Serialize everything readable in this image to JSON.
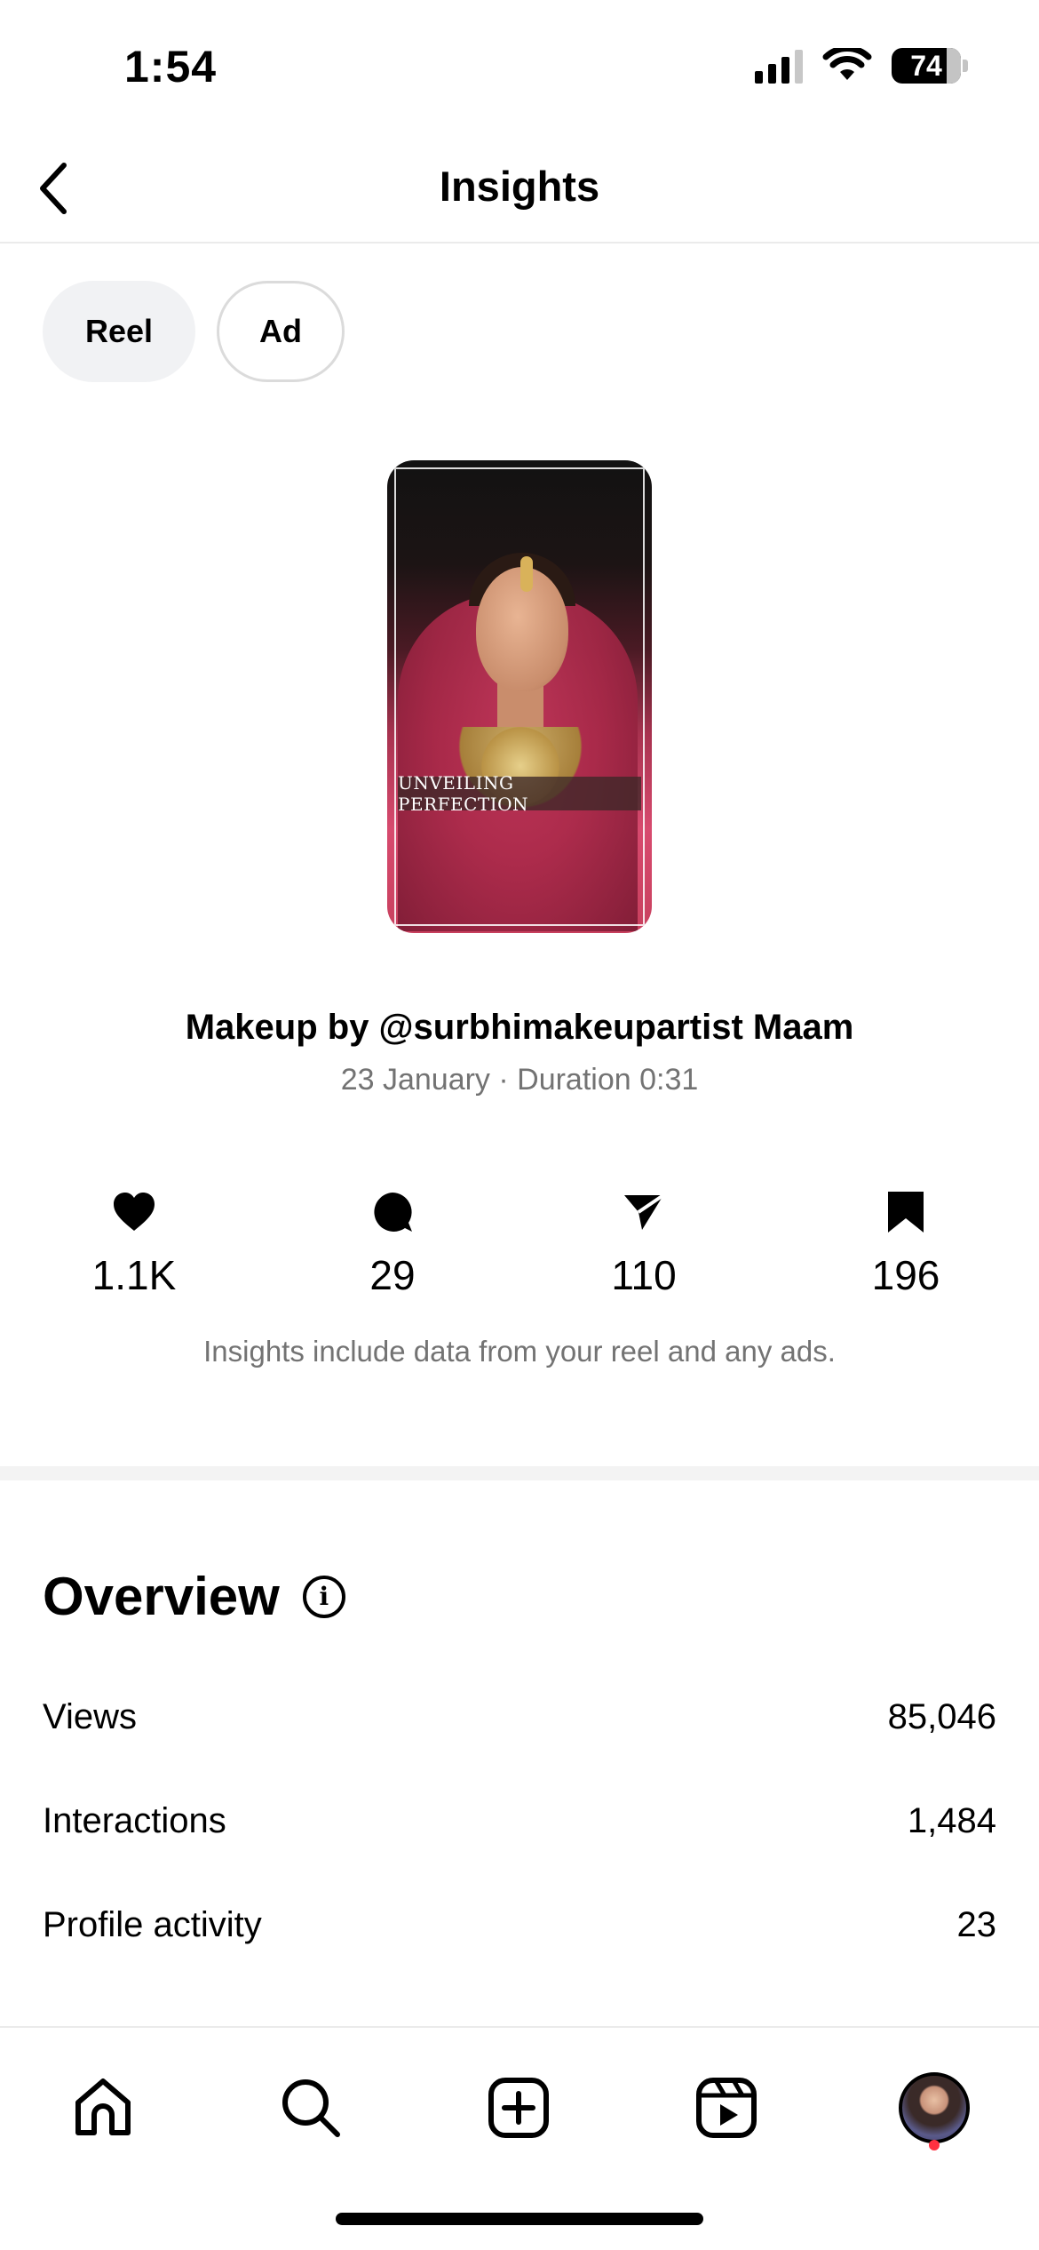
{
  "status_bar": {
    "time": "1:54",
    "battery": "74",
    "icons": [
      "signal-icon",
      "wifi-icon",
      "battery-icon"
    ]
  },
  "header": {
    "title": "Insights",
    "back_icon": "chevron-left-icon"
  },
  "tabs": [
    {
      "label": "Reel",
      "selected": true
    },
    {
      "label": "Ad",
      "selected": false
    }
  ],
  "reel": {
    "thumbnail_caption": "UNVEILING PERFECTION",
    "title": "Makeup by @surbhimakeupartist Maam",
    "meta": "23 January · Duration 0:31"
  },
  "stats": {
    "likes": "1.1K",
    "comments": "29",
    "shares": "110",
    "saves": "196"
  },
  "insights_note": "Insights include data from your reel and any ads.",
  "overview": {
    "title": "Overview",
    "info_icon": "i",
    "rows": [
      {
        "label": "Views",
        "value": "85,046"
      },
      {
        "label": "Interactions",
        "value": "1,484"
      },
      {
        "label": "Profile activity",
        "value": "23"
      }
    ]
  },
  "bottom_nav": {
    "items": [
      "home-icon",
      "search-icon",
      "create-icon",
      "reels-icon",
      "profile-avatar"
    ]
  },
  "colors": {
    "accent_red": "#ff3040",
    "muted_text": "#737373",
    "pill_bg": "#f1f2f4"
  }
}
